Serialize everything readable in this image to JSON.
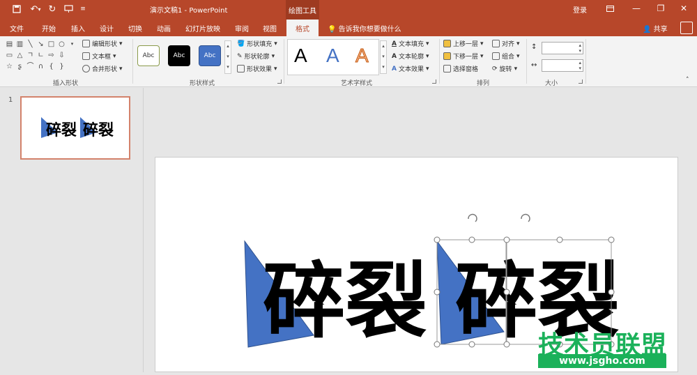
{
  "title_bar": {
    "doc_title": "演示文稿1  -  PowerPoint",
    "context_tab": "绘图工具",
    "login": "登录",
    "brand_color": "#b7472a"
  },
  "tabs": [
    "文件",
    "开始",
    "插入",
    "设计",
    "切换",
    "动画",
    "幻灯片放映",
    "审阅",
    "视图"
  ],
  "active_tab": "格式",
  "tell_me": "告诉我你想要做什么",
  "share": "共享",
  "ribbon": {
    "insert_shapes": {
      "label": "插入形状",
      "edit_shape": "编辑形状",
      "text_box": "文本框",
      "merge_shapes": "合并形状"
    },
    "shape_styles": {
      "label": "形状样式",
      "swatches": [
        "Abc",
        "Abc",
        "Abc"
      ],
      "fill": "形状填充",
      "outline": "形状轮廓",
      "effects": "形状效果"
    },
    "wordart": {
      "label": "艺术字样式",
      "letters": [
        "A",
        "A",
        "A"
      ],
      "text_fill": "文本填充",
      "text_outline": "文本轮廓",
      "text_effects": "文本效果"
    },
    "arrange": {
      "label": "排列",
      "bring_forward": "上移一层",
      "send_backward": "下移一层",
      "selection_pane": "选择窗格",
      "align": "对齐",
      "group": "组合",
      "rotate": "旋转"
    },
    "size": {
      "label": "大小"
    }
  },
  "thumbnail": {
    "number": "1"
  },
  "slide": {
    "text": "碎裂",
    "triangle_color": "#4472c4"
  },
  "watermark": {
    "text": "技术员联盟",
    "url": "www.jsgho.com",
    "color": "#1bb15a"
  }
}
